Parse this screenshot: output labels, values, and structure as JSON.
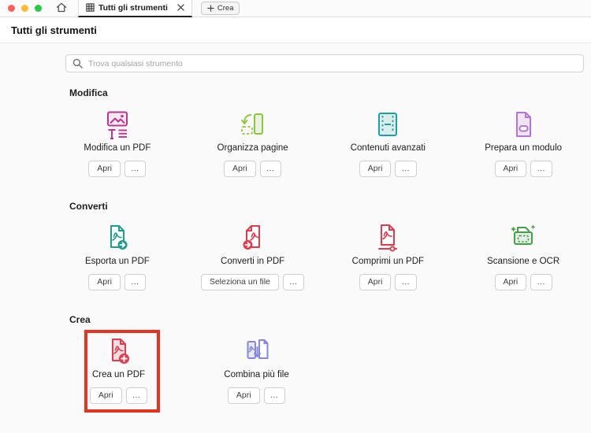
{
  "window": {
    "tab_label": "Tutti gli strumenti",
    "new_tab_label": "Crea",
    "traffic_light_colors": {
      "close": "#ff5f57",
      "minimize": "#febc2e",
      "zoom": "#28c840"
    }
  },
  "page": {
    "title": "Tutti gli strumenti"
  },
  "search": {
    "placeholder": "Trova qualsiasi strumento"
  },
  "highlight": {
    "color": "#e6331f",
    "target": "Crea un PDF"
  },
  "sections": [
    {
      "heading": "Modifica",
      "tools": [
        {
          "label": "Modifica un PDF",
          "icon": "edit-pdf-icon",
          "color": "#c0368d",
          "primary": "Apri",
          "more": "…"
        },
        {
          "label": "Organizza pagine",
          "icon": "organize-pages-icon",
          "color": "#8cc63f",
          "primary": "Apri",
          "more": "…"
        },
        {
          "label": "Contenuti avanzati",
          "icon": "rich-media-icon",
          "color": "#1f9f9f",
          "primary": "Apri",
          "more": "…"
        },
        {
          "label": "Prepara un modulo",
          "icon": "prepare-form-icon",
          "color": "#b674d8",
          "primary": "Apri",
          "more": "…"
        }
      ]
    },
    {
      "heading": "Converti",
      "tools": [
        {
          "label": "Esporta un PDF",
          "icon": "export-pdf-icon",
          "color": "#1d9c90",
          "primary": "Apri",
          "more": "…"
        },
        {
          "label": "Converti in PDF",
          "icon": "convert-to-pdf-icon",
          "color": "#e13c4d",
          "primary": "Seleziona un file",
          "more": "…"
        },
        {
          "label": "Comprimi un PDF",
          "icon": "compress-pdf-icon",
          "color": "#e13c4d",
          "primary": "Apri",
          "more": "…"
        },
        {
          "label": "Scansione e OCR",
          "icon": "scan-ocr-icon",
          "color": "#44a047",
          "primary": "Apri",
          "more": "…"
        }
      ]
    },
    {
      "heading": "Crea",
      "tools": [
        {
          "label": "Crea un PDF",
          "icon": "create-pdf-icon",
          "color": "#e13c4d",
          "primary": "Apri",
          "more": "…",
          "highlighted": true
        },
        {
          "label": "Combina più file",
          "icon": "combine-files-icon",
          "color": "#8787e2",
          "primary": "Apri",
          "more": "…"
        }
      ]
    }
  ]
}
